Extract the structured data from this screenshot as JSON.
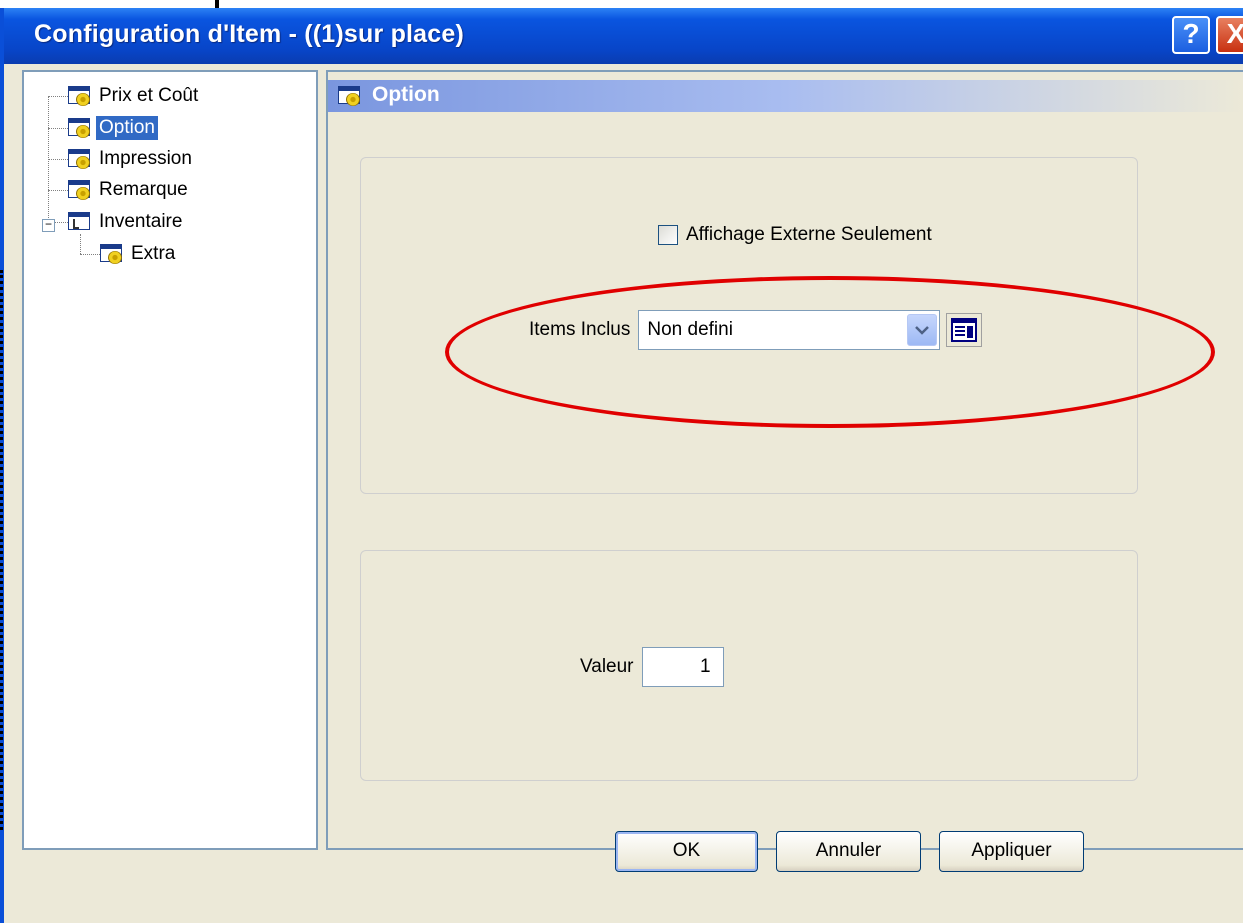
{
  "window": {
    "title": "Configuration d'Item -  ((1)sur place)",
    "help_label": "?",
    "close_label": "X"
  },
  "tree": {
    "items": [
      {
        "label": "Prix et Coût",
        "icon": "settings-window-icon"
      },
      {
        "label": "Option",
        "icon": "settings-window-icon",
        "selected": true
      },
      {
        "label": "Impression",
        "icon": "settings-window-icon"
      },
      {
        "label": "Remarque",
        "icon": "settings-window-icon"
      },
      {
        "label": "Inventaire",
        "icon": "tree-structure-icon",
        "expanded": true
      },
      {
        "label": "Extra",
        "icon": "settings-window-icon",
        "child": true
      }
    ],
    "expander_label": "−"
  },
  "page": {
    "header": "Option",
    "checkbox_label": "Affichage Externe Seulement",
    "items_inclus_label": "Items Inclus",
    "items_inclus_value": "Non defini",
    "valeur_label": "Valeur",
    "valeur_value": "1"
  },
  "buttons": {
    "ok": "OK",
    "annuler": "Annuler",
    "appliquer": "Appliquer"
  },
  "colors": {
    "highlight_ellipse": "#e00000",
    "titlebar": "#0845c8",
    "selection": "#316ac5"
  }
}
